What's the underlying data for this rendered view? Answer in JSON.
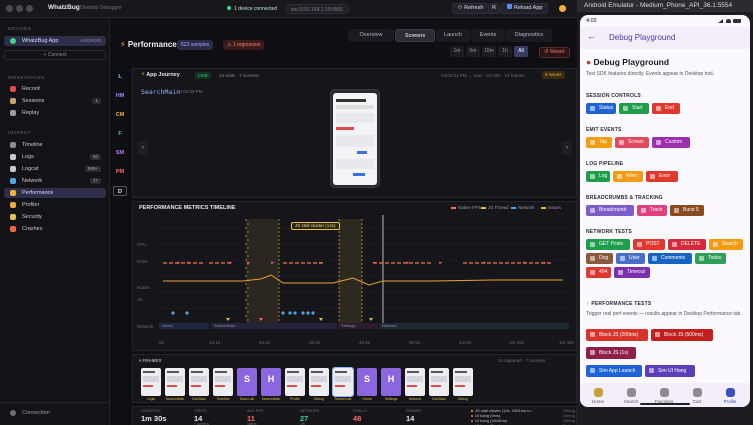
{
  "desktop": {
    "app_name": "WhatzBug",
    "app_sub": "Desktop Debugger",
    "connection": "1 device connected",
    "ws_url": "ws://192.168.1.30:9555",
    "refresh": "Refresh",
    "r_badge": "R",
    "reload": "Reload App"
  },
  "sidebar": {
    "devices_h": "DEVICES",
    "device_name": "WhatzBug App",
    "device_os": "ANDROID",
    "connect": "+ Connect",
    "workspaces_h": "WORKSPACES",
    "inspect_h": "INSPECT",
    "workspaces": [
      {
        "label": "Record",
        "count": "",
        "color": "#e24b4b"
      },
      {
        "label": "Sessions",
        "count": "1",
        "color": "#c9a46a"
      },
      {
        "label": "Replay",
        "count": "",
        "color": "#9a9aa4"
      }
    ],
    "inspect": [
      {
        "label": "Timeline",
        "count": "",
        "color": "#8a8a94"
      },
      {
        "label": "Logs",
        "count": "50",
        "color": "#c9c9d0"
      },
      {
        "label": "Logcat",
        "count": "999+",
        "color": "#c9c9d0"
      },
      {
        "label": "Network",
        "count": "27",
        "color": "#4fa3e6"
      },
      {
        "label": "Performance",
        "count": "",
        "color": "#f2b03c"
      },
      {
        "label": "Profiler",
        "count": "",
        "color": "#f0a93a"
      },
      {
        "label": "Security",
        "count": "",
        "color": "#e6c34a"
      },
      {
        "label": "Crashes",
        "count": "",
        "color": "#f0663c"
      }
    ],
    "connection": "Connection"
  },
  "perf": {
    "title": "Performance",
    "samples": "523 samples",
    "regression": "1 regression",
    "tabs": [
      "Overview",
      "Screens",
      "Launch",
      "Events",
      "Diagnostics"
    ],
    "ranges": [
      "1m",
      "5m",
      "15m",
      "1h",
      "All"
    ],
    "reset": "Reset",
    "rail": [
      {
        "t": "L",
        "c": "#8ad0ff"
      },
      {
        "t": "HM",
        "c": "#9b8cff"
      },
      {
        "t": "CM",
        "c": "#f5b13a"
      },
      {
        "t": "F",
        "c": "#39d98a"
      },
      {
        "t": "SM",
        "c": "#b87cff"
      },
      {
        "t": "PM",
        "c": "#ff6b6b"
      },
      {
        "t": "D",
        "c": "#e0e0e6"
      }
    ]
  },
  "journey": {
    "title": "App Journey",
    "live": "LIVE",
    "stats": "14 visits · 7 screens",
    "screen": "SearchMain",
    "time": "04:02:56 PM",
    "right_meta": "04:01:01 PM → now · 1m 30s · 14 frames",
    "issues": "8 issues"
  },
  "timeline": {
    "title": "PERFORMANCE METRICS TIMELINE",
    "legend": [
      "Native FPS",
      "JS Thread",
      "Network",
      "Issues"
    ],
    "legend_colors": [
      "#f07a3c",
      "#e8c14a",
      "#4fa3e6",
      "#f2b03c"
    ],
    "tooltip": "JS stall cluster (14x)",
    "rows": [
      "CPU",
      "RAM",
      "Native",
      "JS",
      "Network"
    ],
    "x_ticks": [
      "0s",
      "10.1s",
      "20.2s",
      "30.3s",
      "40.4s",
      "50.5s",
      "1m 0s",
      "1m 10s",
      "1m 30s"
    ],
    "screens": [
      "Home",
      "SearchMain",
      "Settings",
      "Network"
    ]
  },
  "frames": {
    "title": "FRAMES",
    "count": "14 captured · 7 screens",
    "labels": [
      "Login",
      "SearchMain",
      "CartMain",
      "Timeline",
      "Scan Lab",
      "SearchMain",
      "Profile",
      "Debug",
      "SearchLab",
      "Home",
      "Settings",
      "Network",
      "CartMain",
      "Debug"
    ]
  },
  "stats": [
    {
      "label": "DURATION",
      "value": "1m 30s",
      "sub": "",
      "color": "#e8e8ee"
    },
    {
      "label": "VISITS",
      "value": "14",
      "sub": "7 screens",
      "color": "#e8e8ee"
    },
    {
      "label": "AVG FPS",
      "value": "11",
      "sub": "Native",
      "color": "#ff6b5b"
    },
    {
      "label": "NETWORK",
      "value": "27",
      "sub": "OK",
      "color": "#39d98a"
    },
    {
      "label": "STALLS",
      "value": "48",
      "sub": "",
      "color": "#ff6b6b"
    },
    {
      "label": "FRAMES",
      "value": "14",
      "sub": "",
      "color": "#e8e8ee"
    }
  ],
  "issue_list": [
    {
      "text": "JS stall cluster (14x, 4351ms to...",
      "tag": "Debug",
      "color": "#f2b03c"
    },
    {
      "text": "UI hang (9ms)",
      "tag": "Debug",
      "color": "#ff6b6b"
    },
    {
      "text": "UI hang (4418ms)",
      "tag": "Debug",
      "color": "#ff6b6b"
    },
    {
      "text": "UI hang (9ms)",
      "tag": "Debug",
      "color": "#ff6b6b"
    }
  ],
  "emulator": {
    "title": "Android Emulator - Medium_Phone_API_36.1:5554",
    "time": "4:02",
    "appbar": "Debug Playground",
    "heading": "Debug Playground",
    "desc": "Test SDK features directly. Events appear in Desktop tool.",
    "sections": [
      {
        "title": "SESSION CONTROLS",
        "chips": [
          {
            "label": "Status",
            "color": "#1e63d6"
          },
          {
            "label": "Start",
            "color": "#1e9e4a"
          },
          {
            "label": "End",
            "color": "#e0382e"
          }
        ]
      },
      {
        "title": "EMIT EVENTS",
        "chips": [
          {
            "label": "Tap",
            "color": "#f39c12"
          },
          {
            "label": "Screen",
            "color": "#e24a5f"
          },
          {
            "label": "Custom",
            "color": "#9b2fae"
          }
        ]
      },
      {
        "title": "LOG PIPELINE",
        "chips": [
          {
            "label": "Log",
            "color": "#1e9e4a"
          },
          {
            "label": "Warn",
            "color": "#f39c12"
          },
          {
            "label": "Error",
            "color": "#e0382e"
          }
        ]
      },
      {
        "title": "BREADCRUMBS & TRACKING",
        "chips": [
          {
            "label": "Breadcrumb",
            "color": "#7c5cc6"
          },
          {
            "label": "Track",
            "color": "#e0417e"
          },
          {
            "label": "Burst 5",
            "color": "#8a4a1e"
          }
        ]
      },
      {
        "title": "NETWORK TESTS",
        "chips": [
          {
            "label": "GET Posts",
            "color": "#1e9e4a"
          },
          {
            "label": "POST",
            "color": "#e0382e"
          },
          {
            "label": "DELETE",
            "color": "#d42a3a"
          },
          {
            "label": "Search",
            "color": "#f39c12"
          },
          {
            "label": "Dog",
            "color": "#8a5a3e"
          },
          {
            "label": "User",
            "color": "#4a6fc8"
          },
          {
            "label": "Comments",
            "color": "#1565c0"
          },
          {
            "label": "Todos",
            "color": "#2e9e5a"
          },
          {
            "label": "404",
            "color": "#e0382e"
          },
          {
            "label": "Timeout",
            "color": "#7a2fae"
          }
        ]
      },
      {
        "title": "PERFORMANCE TESTS",
        "chips": []
      }
    ],
    "perf_desc": "Trigger real perf events — results appear in Desktop Performance tab.",
    "perf_chips": [
      {
        "label": "Block JS (200ms)",
        "color": "#d9342b"
      },
      {
        "label": "Block JS (500ms)",
        "color": "#c21f1f"
      },
      {
        "label": "Block JS (1s)",
        "color": "#8e1f4a"
      },
      {
        "label": "Sim App Launch",
        "color": "#1e63d6"
      },
      {
        "label": "Sim UI Hang",
        "color": "#5a3fb8"
      }
    ],
    "nav": [
      "Home",
      "Search",
      "Favorites",
      "Cart",
      "Profile"
    ]
  }
}
